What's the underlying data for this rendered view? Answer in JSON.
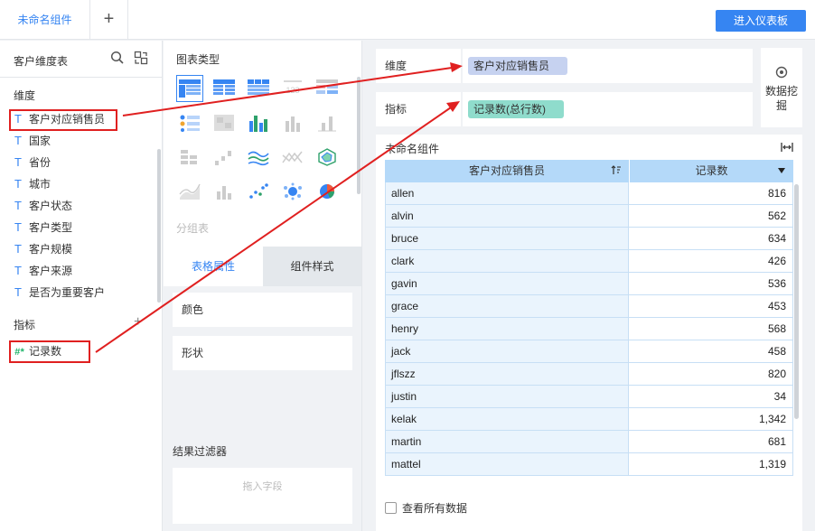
{
  "topbar": {
    "tab_label": "未命名组件",
    "add_tab_symbol": "+",
    "enter_dashboard_label": "进入仪表板"
  },
  "left_panel": {
    "table_name": "客户维度表",
    "dimension_title": "维度",
    "dimensions": [
      "客户对应销售员",
      "国家",
      "省份",
      "城市",
      "客户状态",
      "客户类型",
      "客户规模",
      "客户来源",
      "是否为重要客户"
    ],
    "dimension_type_symbol": "T",
    "metric_title": "指标",
    "metric_add_symbol": "+",
    "metric_type_symbol": "#*",
    "metrics": [
      "记录数"
    ]
  },
  "middle_panel": {
    "chart_type_title": "图表类型",
    "chart_icons": [
      "group-table-icon",
      "cross-table-icon",
      "detail-table-icon",
      "kpi-icon",
      "heat-table-icon",
      "dot-matrix-icon",
      "heat-map-icon",
      "grouped-bar-icon",
      "bar-icon",
      "column-icon",
      "stacked-bar-icon",
      "waterfall-icon",
      "multi-line-icon",
      "line-icon",
      "radar-icon",
      "area-icon",
      "column-small-icon",
      "scatter-icon",
      "bubble-icon",
      "pie-icon"
    ],
    "selected_chart_label": "分组表",
    "tab_table_props": "表格属性",
    "tab_comp_style": "组件样式",
    "prop_color": "颜色",
    "prop_shape": "形状",
    "filter_title": "结果过滤器",
    "filter_placeholder": "拖入字段"
  },
  "right_panel": {
    "dimension_label": "维度",
    "dimension_pill": "客户对应销售员",
    "dimension_pill_color": "#c6d2f0",
    "metric_label": "指标",
    "metric_pill": "记录数(总行数)",
    "metric_pill_color": "#8fdccc",
    "mining_label": "数据挖掘",
    "component_title": "未命名组件",
    "table": {
      "columns": [
        "客户对应销售员",
        "记录数"
      ],
      "rows": [
        [
          "allen",
          "816"
        ],
        [
          "alvin",
          "562"
        ],
        [
          "bruce",
          "634"
        ],
        [
          "clark",
          "426"
        ],
        [
          "gavin",
          "536"
        ],
        [
          "grace",
          "453"
        ],
        [
          "henry",
          "568"
        ],
        [
          "jack",
          "458"
        ],
        [
          "jflszz",
          "820"
        ],
        [
          "justin",
          "34"
        ],
        [
          "kelak",
          "1,342"
        ],
        [
          "martin",
          "681"
        ],
        [
          "mattel",
          "1,319"
        ]
      ]
    },
    "view_all_label": "查看所有数据"
  },
  "colors": {
    "accent": "#3685f2",
    "annotation": "#e02020",
    "header_bg": "#b4d9f9"
  }
}
